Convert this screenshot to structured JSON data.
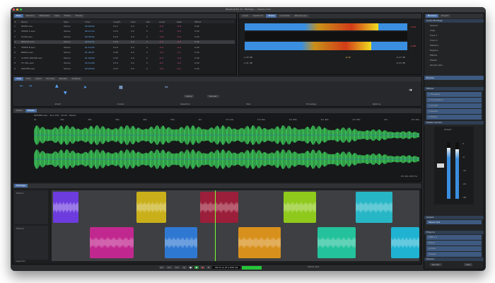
{
  "window": {
    "title": "WaveLab Pro 11 · Montage — Session.mon"
  },
  "top_left": {
    "tabs": [
      "Files",
      "Markers",
      "Metadata",
      "Clips",
      "Editor",
      "Tracks"
    ],
    "columns": [
      "#",
      "Name",
      "Type",
      "Time",
      "Length",
      "Gain",
      "Pan",
      "Level",
      "Peak",
      "Offset"
    ],
    "rows": [
      {
        "num": "1",
        "name": "INTRO.wav",
        "type": "Stereo",
        "time": "00:00:00",
        "len": "0:12",
        "gain": "0.0",
        "pan": "C",
        "lvl": "-3.0",
        "peak": "-0.8",
        "off": "0.00"
      },
      {
        "num": "2",
        "name": "VERSE A.wav",
        "type": "Stereo",
        "time": "00:12:10",
        "len": "0:24",
        "gain": "0.0",
        "pan": "C",
        "lvl": "-2.1",
        "peak": "-0.5",
        "off": "0.00"
      },
      {
        "num": "3",
        "name": "HOOK.wav",
        "type": "Stereo",
        "time": "00:36:02",
        "len": "0:16",
        "gain": "0.0",
        "pan": "C",
        "lvl": "-1.8",
        "peak": "-0.3",
        "off": "0.00"
      },
      {
        "num": "4",
        "name": "BRIDGE.wav",
        "type": "Stereo",
        "time": "00:52:11",
        "len": "0:20",
        "gain": "0.0",
        "pan": "C",
        "lvl": "-2.4",
        "peak": "-0.6",
        "off": "0.00"
      },
      {
        "num": "5",
        "name": "VERSE B.wav",
        "type": "Stereo",
        "time": "01:12:03",
        "len": "0:24",
        "gain": "0.0",
        "pan": "C",
        "lvl": "-2.0",
        "peak": "-0.4",
        "off": "0.00"
      },
      {
        "num": "6",
        "name": "BREAK.wav",
        "type": "Stereo",
        "time": "01:36:07",
        "len": "0:08",
        "gain": "0.0",
        "pan": "C",
        "lvl": "-4.2",
        "peak": "-1.1",
        "off": "0.00"
      },
      {
        "num": "7",
        "name": "OUTRO DRONE.wav",
        "type": "Stereo",
        "time": "01:44:00",
        "len": "0:30",
        "gain": "0.0",
        "pan": "C",
        "lvl": "-5.0",
        "peak": "-1.6",
        "off": "0.00"
      },
      {
        "num": "8",
        "name": "FX TAIL.wav",
        "type": "Stereo",
        "time": "02:14:09",
        "len": "0:10",
        "gain": "0.0",
        "pan": "C",
        "lvl": "-6.3",
        "peak": "-2.0",
        "off": "0.00"
      },
      {
        "num": "9",
        "name": "MASTER.wav",
        "type": "Stereo",
        "time": "00:00:00",
        "len": "2:24",
        "gain": "0.0",
        "pan": "C",
        "lvl": "-1.0",
        "peak": "-0.1",
        "off": "0.00"
      }
    ]
  },
  "meter": {
    "tabs": [
      "Level",
      "Spectrum",
      "Phase",
      "Loudness",
      "Wavescope"
    ],
    "left_lower": "-1.33 dB",
    "left_lower2": "-1.31 dB",
    "center": "-0.72",
    "right_lower": "-0.47 dB",
    "right_lower2": "-0.23 dB",
    "peak_l": "-1.04",
    "peak_r": "-0.98",
    "level_left": 0.82,
    "level_right": 0.78
  },
  "toolbar": {
    "tabs": [
      "View",
      "Edit",
      "Insert",
      "Process",
      "Render",
      "Analyze"
    ],
    "groups": [
      "Zoom",
      "Cursor",
      "Selection",
      "Clip",
      "Envelope",
      "Options"
    ],
    "btn_apply": "Apply",
    "btn_render": "Render"
  },
  "wave": {
    "tabs": [
      "Editor",
      "Master"
    ],
    "file": "MASTER.wav · 44.1 kHz · 24 bit · Stereo",
    "ruler": [
      "0s",
      "10s",
      "20s",
      "30s",
      "40s",
      "50s",
      "1m",
      "1m 10s",
      "1m 20s",
      "1m 30s",
      "1m 40s",
      "1m 50s",
      "2m",
      "2m 10s"
    ],
    "status": "2m 24s 443 ms"
  },
  "montage": {
    "title": "Montage",
    "tracks": [
      "Track 1",
      "Track 2"
    ],
    "track_btn": [
      "M",
      "S",
      "R"
    ],
    "bottom_left": "Inspector",
    "bottom_left2": "Navigator"
  },
  "transport": {
    "time": "00:11 m 47 s 643 ms",
    "right": "Stereo Out",
    "buttons": [
      "|<",
      "<<",
      ">>",
      ">|",
      "■",
      "▶",
      "●",
      "↺"
    ]
  },
  "right_panel": {
    "top_tabs": [
      "Browser",
      "Project"
    ],
    "tree_header": "Audio Montage",
    "tree": [
      "Session",
      "Clips",
      "Track 1",
      "Track 2",
      "Markers",
      "Regions",
      "Effects",
      "Master",
      "Render Jobs"
    ],
    "browser_btn": "Browse",
    "fx_header": "Effects",
    "fx_items": [
      "1  Equalizer",
      "2  Compressor",
      "3  Limiter",
      "4  Reverb",
      "5  Dither"
    ],
    "meter_header": "Master Section",
    "meter_ticks": [
      "0",
      "-6",
      "-12",
      "-24",
      "-48"
    ],
    "fader_label": "Output",
    "output_header": "Output",
    "output_items": [
      "Stereo Out"
    ],
    "plugins_header": "Plug-ins",
    "plugins_items": [
      "MBD 12",
      "Dither",
      "Limiter",
      "Output"
    ],
    "footer_header": "Monitor",
    "footer_btn": [
      "Render",
      "Play"
    ]
  },
  "colors": {
    "accent": "#4a7fc1",
    "wave": "#3fd45c",
    "clip_purple": "#6c3cde",
    "clip_yellow": "#c9b01a",
    "clip_red": "#9b1f3a",
    "clip_lime": "#8fc91c",
    "clip_cyan": "#27b6c6",
    "clip_magenta": "#c1288f",
    "clip_blue": "#2f78d2",
    "clip_orange": "#d8901d",
    "clip_teal": "#23c29c",
    "clip_sky": "#1fb3d1"
  }
}
